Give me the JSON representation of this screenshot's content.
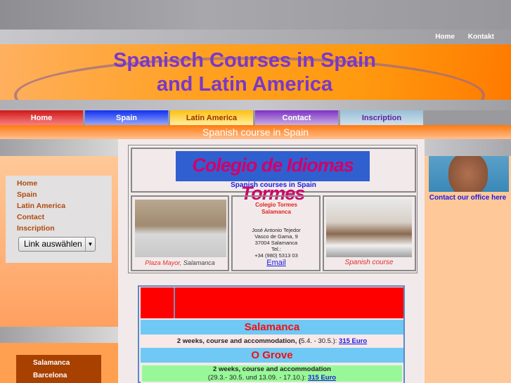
{
  "top_links": [
    "Home",
    "Kontakt"
  ],
  "banner": {
    "line1": "Spanisch Courses in Spain",
    "line2": "and Latin America"
  },
  "tabs": [
    {
      "label": "Home",
      "color": "#e83838"
    },
    {
      "label": "Spain",
      "color": "#3050f0"
    },
    {
      "label": "Latin America",
      "color": "#ffd030"
    },
    {
      "label": "Contact",
      "color": "#9040c8"
    },
    {
      "label": "Inscription",
      "color": "#a8c8e0"
    }
  ],
  "subtitle": "Spanish course in Spain",
  "left_nav": {
    "items": [
      "Home",
      "Spain",
      "Latin America",
      "Contact",
      "Inscription"
    ],
    "select": "Link auswählen"
  },
  "cities": [
    "Salamanca",
    "Barcelona"
  ],
  "school": {
    "logo": "Colegio de Idiomas Tormes",
    "tagline": "Spanish courses in Spain",
    "photo1_caption_red": "Plaza Mayor,",
    "photo1_caption": "Salamanca",
    "name1": "Colegio Tormes",
    "name2": "Salamanca",
    "address": [
      "José Antonio Tejedor",
      "Vasco de Gama, 9",
      "37004 Salamanca",
      "Tel.:",
      "+34 (980) 5313 03"
    ],
    "email": "Email",
    "photo2_caption": "Spanish course"
  },
  "right": {
    "contact": "Contact our office here"
  },
  "offers": [
    {
      "city": "Salamanca",
      "text": "2 weeks, course and accommodation, (",
      "dates": "5.4. - 30.5.):",
      "price": "315 Euro"
    },
    {
      "city": "O Grove",
      "text": "2 weeks, course and accommodation",
      "dates": "(29.3.- 30.5. und 13.09. - 17.10.):",
      "price": "315 Euro"
    }
  ]
}
